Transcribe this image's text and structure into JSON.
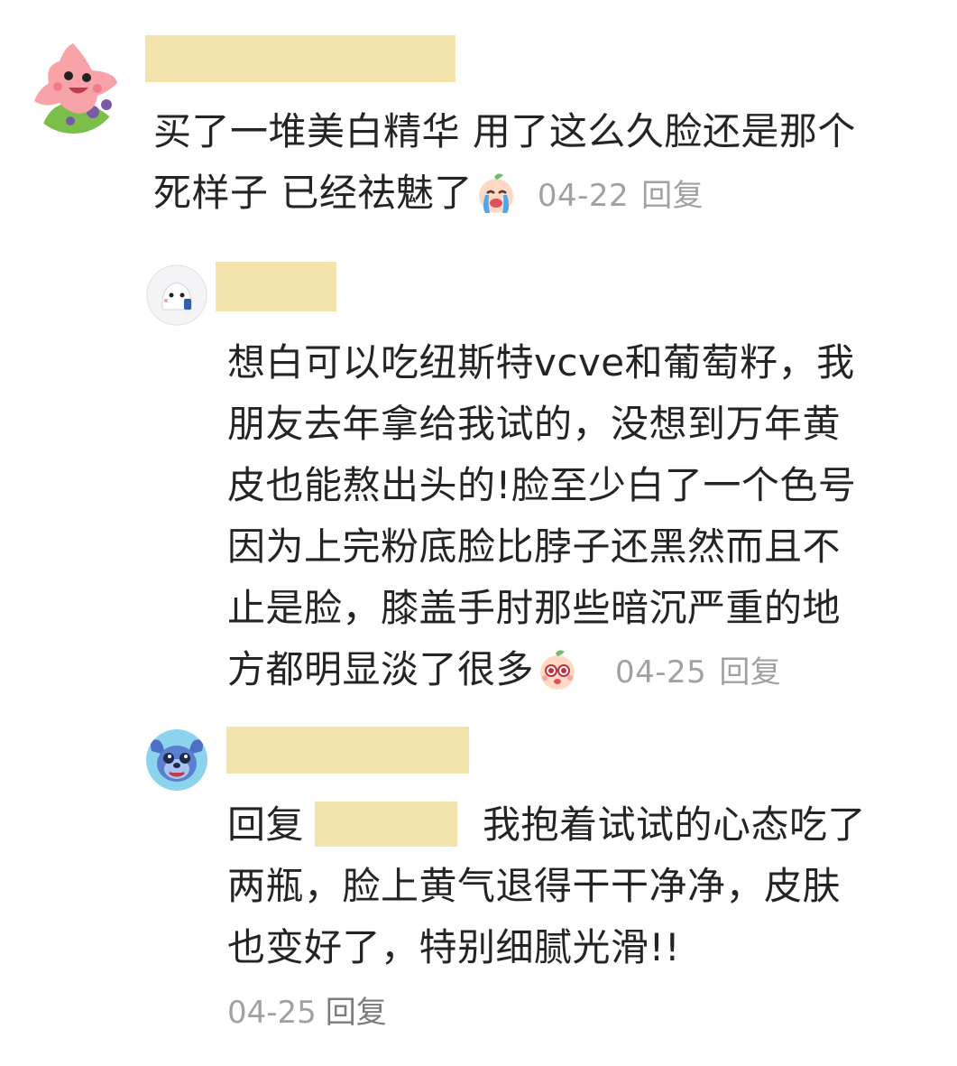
{
  "comments": [
    {
      "avatar_icon": "pink-starfish-avatar-icon",
      "text_lines": [
        "买了一堆美白精华 用了这么久脸还是那个",
        "死样子 已经祛魅了"
      ],
      "emoji_icon": "crying-peach-emoji-icon",
      "date": "04-22",
      "reply_label": "回复"
    },
    {
      "avatar_icon": "cartoon-ghost-avatar-icon",
      "text_lines": [
        "想白可以吃纽斯特vcve和葡萄籽，我",
        "朋友去年拿给我试的，没想到万年黄",
        "皮也能熬出头的!脸至少白了一个色号",
        "因为上完粉底脸比脖子还黑然而且不",
        "止是脸，膝盖手肘那些暗沉严重的地",
        "方都明显淡了很多"
      ],
      "emoji_icon": "starry-eyed-peach-emoji-icon",
      "date": "04-25",
      "reply_label": "回复"
    },
    {
      "avatar_icon": "stitch-avatar-icon",
      "reply_prefix": "回复",
      "first_line_rest": "我抱着试试的心态吃了",
      "text_lines": [
        "两瓶，脸上黄气退得干干净净，皮肤",
        "也变好了，特别细腻光滑!!"
      ],
      "date": "04-25",
      "reply_label": "回复"
    }
  ],
  "colors": {
    "name_redaction": "#f3e3ad",
    "meta_gray": "#a1a1a1",
    "reply_gray": "#7c7c7c",
    "text": "#242424"
  }
}
